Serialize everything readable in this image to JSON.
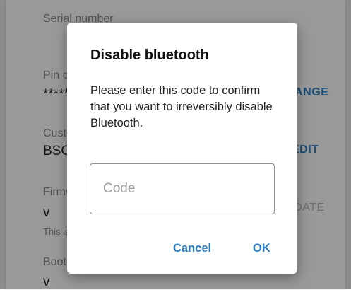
{
  "background": {
    "fields": [
      {
        "label": "Serial number",
        "value": ""
      },
      {
        "label": "Pin code",
        "value": "******",
        "action": "CHANGE"
      },
      {
        "label": "Custom name",
        "value": "BSC",
        "action": "EDIT"
      },
      {
        "label": "Firmware",
        "value": "v",
        "note": "This is the latest version",
        "action": "UPDATE"
      },
      {
        "label": "Bootloader",
        "value": "v"
      }
    ]
  },
  "dialog": {
    "title": "Disable bluetooth",
    "message": "Please enter this code to confirm that you want to irreversibly disable Bluetooth.",
    "input": {
      "value": "",
      "placeholder": "Code"
    },
    "cancel_label": "Cancel",
    "ok_label": "OK"
  },
  "colors": {
    "accent": "#2d7fc1",
    "scrim": "rgba(0,0,0,0.40)"
  }
}
